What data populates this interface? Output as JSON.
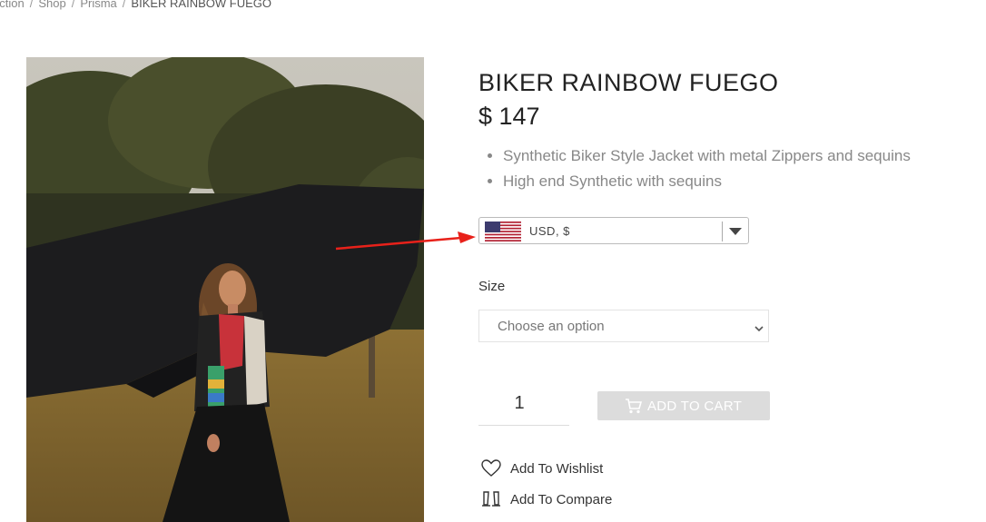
{
  "breadcrumb": {
    "items": [
      "ection",
      "Shop",
      "Prisma"
    ],
    "separator": "/",
    "current": "BIKER RAINBOW FUEGO"
  },
  "product": {
    "title": "BIKER RAINBOW FUEGO",
    "price": "$ 147",
    "features": [
      "Synthetic Biker Style Jacket with metal Zippers and sequins",
      "High end Synthetic with sequins"
    ]
  },
  "currency_selector": {
    "flag_icon": "us-flag-icon",
    "selected": "USD, $"
  },
  "size": {
    "label": "Size",
    "placeholder": "Choose an option"
  },
  "quantity": {
    "value": "1"
  },
  "cart": {
    "label": "ADD TO CART",
    "icon": "cart-icon"
  },
  "actions": {
    "wishlist": {
      "label": "Add To Wishlist",
      "icon": "heart-icon"
    },
    "compare": {
      "label": "Add To Compare",
      "icon": "compare-icon"
    }
  },
  "colors": {
    "annotation_arrow": "#e8211a",
    "button_disabled": "#dcdcdc"
  }
}
